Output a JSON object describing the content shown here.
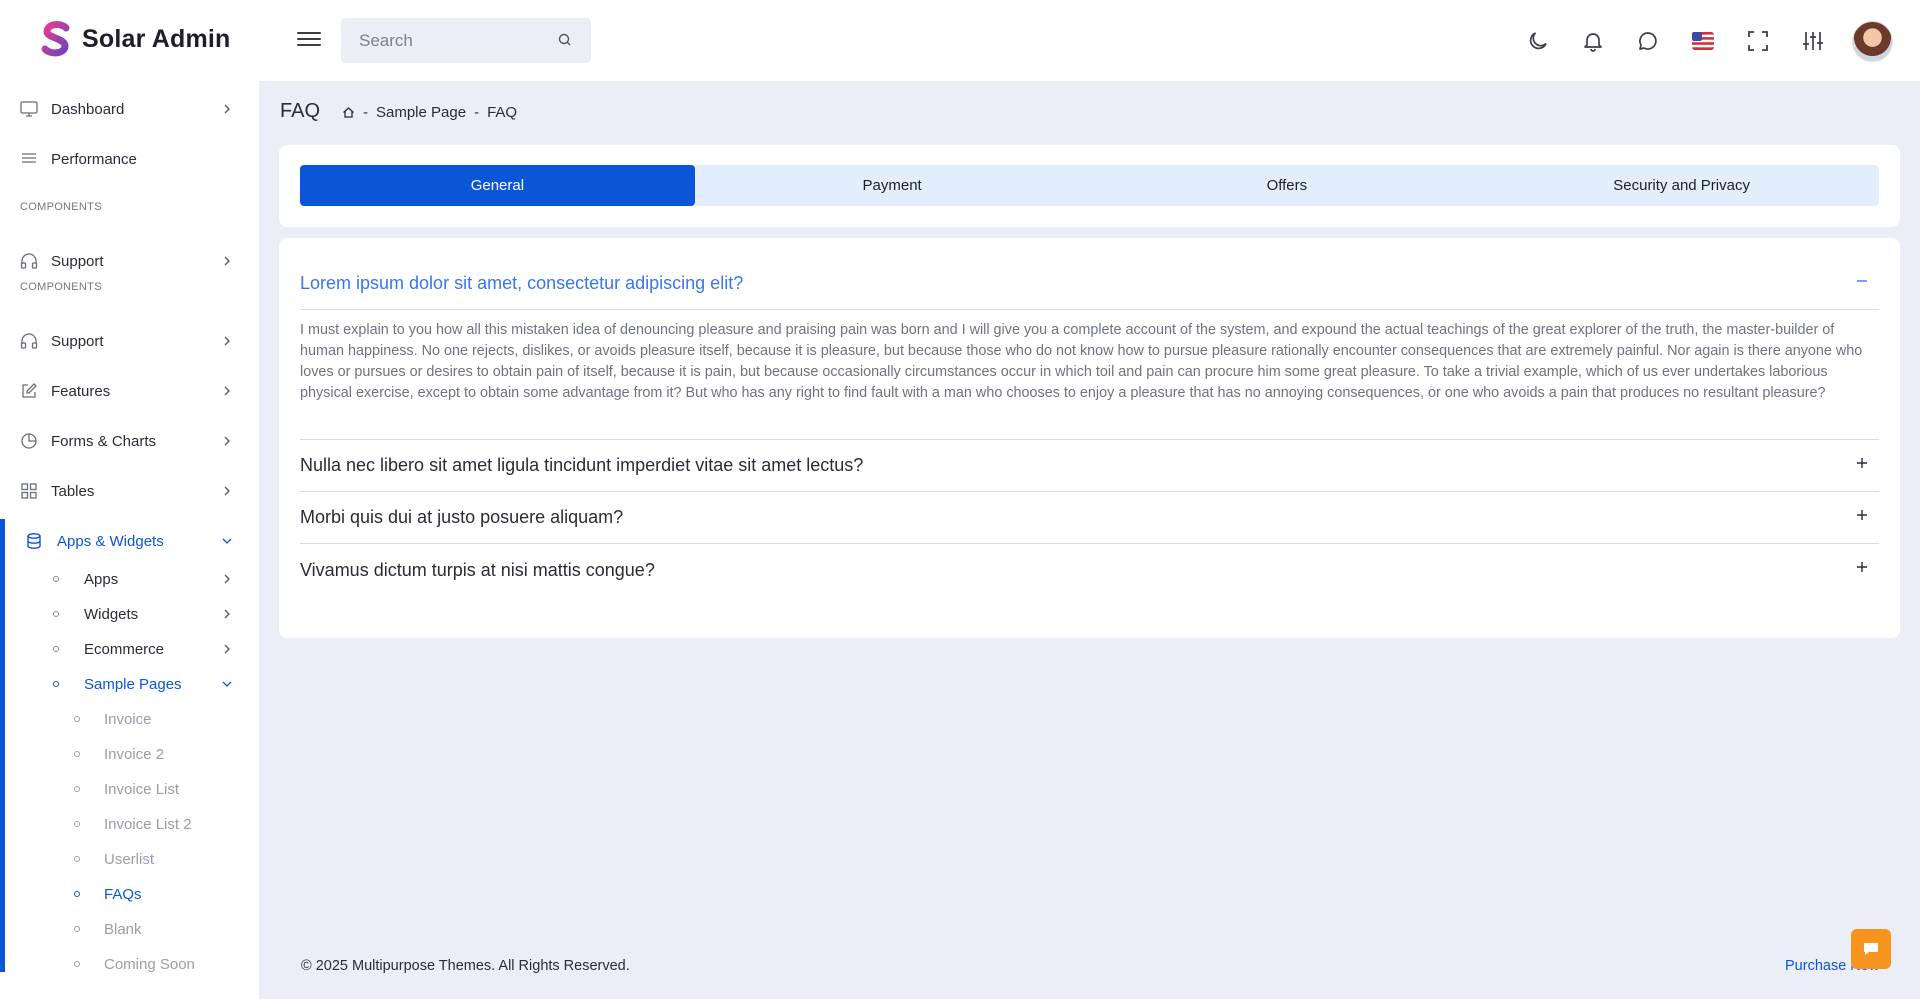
{
  "brand": {
    "name": "Solar Admin",
    "logo_color_top": "#e83e8c",
    "logo_color_bottom": "#6f42c1"
  },
  "header": {
    "search_placeholder": "Search",
    "icons": [
      "moon-icon",
      "bell-icon",
      "chat-icon",
      "us-flag-icon",
      "fullscreen-icon",
      "sliders-icon",
      "avatar"
    ]
  },
  "sidebar": {
    "items": [
      {
        "label": "Dashboard",
        "icon": "monitor-icon"
      },
      {
        "label": "Performance",
        "icon": "list-icon"
      },
      {
        "section": "COMPONENTS"
      },
      {
        "label": "Support",
        "icon": "headphones-icon"
      },
      {
        "section": "COMPONENTS"
      },
      {
        "label": "Support",
        "icon": "headphones-icon"
      },
      {
        "label": "Features",
        "icon": "edit-icon"
      },
      {
        "label": "Forms & Charts",
        "icon": "pie-chart-icon"
      },
      {
        "label": "Tables",
        "icon": "grid-icon"
      },
      {
        "label": "Apps & Widgets",
        "icon": "database-icon"
      }
    ],
    "sections": [
      "COMPONENTS",
      "COMPONENTS"
    ],
    "main": [
      "Dashboard",
      "Performance",
      "Support",
      "Support",
      "Features",
      "Forms & Charts",
      "Tables",
      "Apps & Widgets"
    ],
    "sub": [
      "Apps",
      "Widgets",
      "Ecommerce",
      "Sample Pages"
    ],
    "sub2": [
      "Invoice",
      "Invoice 2",
      "Invoice List",
      "Invoice List 2",
      "Userlist",
      "FAQs",
      "Blank",
      "Coming Soon"
    ]
  },
  "page": {
    "title": "FAQ",
    "breadcrumb": [
      "Sample Page",
      "FAQ"
    ],
    "separator": "-"
  },
  "tabs": [
    "General",
    "Payment",
    "Offers",
    "Security and Privacy"
  ],
  "faq": [
    {
      "question": "Lorem ipsum dolor sit amet, consectetur adipiscing elit?",
      "answer": "I must explain to you how all this mistaken idea of denouncing pleasure and praising pain was born and I will give you a complete account of the system, and expound the actual teachings of the great explorer of the truth, the master-builder of human happiness. No one rejects, dislikes, or avoids pleasure itself, because it is pleasure, but because those who do not know how to pursue pleasure rationally encounter consequences that are extremely painful. Nor again is there anyone who loves or pursues or desires to obtain pain of itself, because it is pain, but because occasionally circumstances occur in which toil and pain can procure him some great pleasure. To take a trivial example, which of us ever undertakes laborious physical exercise, except to obtain some advantage from it? But who has any right to find fault with a man who chooses to enjoy a pleasure that has no annoying consequences, or one who avoids a pain that produces no resultant pleasure?",
      "expanded": true
    },
    {
      "question": "Nulla nec libero sit amet ligula tincidunt imperdiet vitae sit amet lectus?",
      "expanded": false
    },
    {
      "question": "Morbi quis dui at justo posuere aliquam?",
      "expanded": false
    },
    {
      "question": "Vivamus dictum turpis at nisi mattis congue?",
      "expanded": false
    }
  ],
  "footer": {
    "copyright": "© 2025 Multipurpose Themes. All Rights Reserved.",
    "purchase": "Purchase Now"
  },
  "colors": {
    "primary": "#0b56d6",
    "accent_link": "#3b74f1",
    "chat_button": "#f7941d",
    "background": "#ebedf7"
  }
}
